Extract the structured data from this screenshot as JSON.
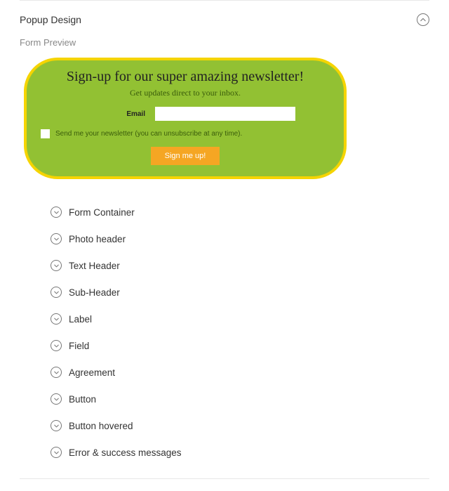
{
  "section": {
    "title": "Popup Design",
    "form_preview_label": "Form Preview"
  },
  "popup": {
    "title": "Sign-up for our super amazing newsletter!",
    "subtitle": "Get updates direct to your inbox.",
    "email_label": "Email",
    "email_value": "",
    "agree_text": "Send me your newsletter (you can unsubscribe at any time).",
    "button_label": "Sign me up!"
  },
  "settings": [
    {
      "label": "Form Container"
    },
    {
      "label": "Photo header"
    },
    {
      "label": "Text Header"
    },
    {
      "label": "Sub-Header"
    },
    {
      "label": "Label"
    },
    {
      "label": "Field"
    },
    {
      "label": "Agreement"
    },
    {
      "label": "Button"
    },
    {
      "label": "Button hovered"
    },
    {
      "label": "Error & success messages"
    }
  ]
}
